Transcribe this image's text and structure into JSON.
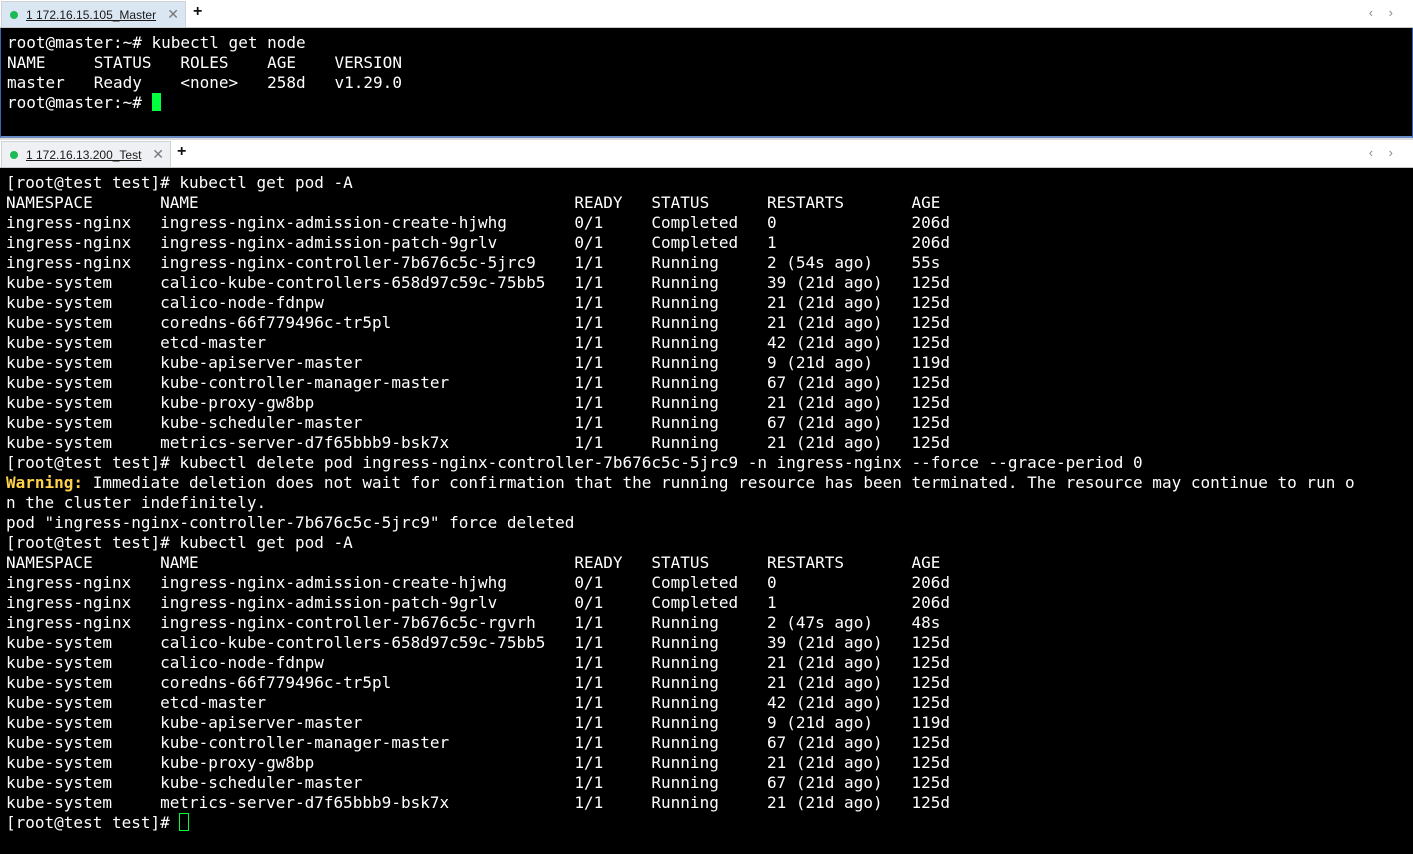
{
  "tabs": {
    "top": {
      "title": "1 172.16.15.105_Master",
      "status_color": "#1db954",
      "close": "✕",
      "new": "+",
      "nav": "‹ ›"
    },
    "bottom": {
      "title": "1 172.16.13.200_Test",
      "status_color": "#1db954",
      "close": "✕",
      "new": "+",
      "nav": "‹ ›"
    }
  },
  "master_terminal": {
    "lines": [
      "root@master:~# kubectl get node",
      "NAME     STATUS   ROLES    AGE    VERSION",
      "master   Ready    <none>   258d   v1.29.0",
      "root@master:~# "
    ]
  },
  "test_terminal": {
    "lines": [
      "[root@test test]# kubectl get pod -A",
      "NAMESPACE       NAME                                       READY   STATUS      RESTARTS       AGE",
      "ingress-nginx   ingress-nginx-admission-create-hjwhg       0/1     Completed   0              206d",
      "ingress-nginx   ingress-nginx-admission-patch-9grlv        0/1     Completed   1              206d",
      "ingress-nginx   ingress-nginx-controller-7b676c5c-5jrc9    1/1     Running     2 (54s ago)    55s",
      "kube-system     calico-kube-controllers-658d97c59c-75bb5   1/1     Running     39 (21d ago)   125d",
      "kube-system     calico-node-fdnpw                          1/1     Running     21 (21d ago)   125d",
      "kube-system     coredns-66f779496c-tr5pl                   1/1     Running     21 (21d ago)   125d",
      "kube-system     etcd-master                                1/1     Running     42 (21d ago)   125d",
      "kube-system     kube-apiserver-master                      1/1     Running     9 (21d ago)    119d",
      "kube-system     kube-controller-manager-master             1/1     Running     67 (21d ago)   125d",
      "kube-system     kube-proxy-gw8bp                           1/1     Running     21 (21d ago)   125d",
      "kube-system     kube-scheduler-master                      1/1     Running     67 (21d ago)   125d",
      "kube-system     metrics-server-d7f65bbb9-bsk7x             1/1     Running     21 (21d ago)   125d",
      "[root@test test]# kubectl delete pod ingress-nginx-controller-7b676c5c-5jrc9 -n ingress-nginx --force --grace-period 0"
    ],
    "warning_label": "Warning:",
    "warning_rest": " Immediate deletion does not wait for confirmation that the running resource has been terminated. The resource may continue to run o",
    "warning_wrap": "n the cluster indefinitely.",
    "lines_after": [
      "pod \"ingress-nginx-controller-7b676c5c-5jrc9\" force deleted",
      "[root@test test]# kubectl get pod -A",
      "NAMESPACE       NAME                                       READY   STATUS      RESTARTS       AGE",
      "ingress-nginx   ingress-nginx-admission-create-hjwhg       0/1     Completed   0              206d",
      "ingress-nginx   ingress-nginx-admission-patch-9grlv        0/1     Completed   1              206d",
      "ingress-nginx   ingress-nginx-controller-7b676c5c-rgvrh    1/1     Running     2 (47s ago)    48s",
      "kube-system     calico-kube-controllers-658d97c59c-75bb5   1/1     Running     39 (21d ago)   125d",
      "kube-system     calico-node-fdnpw                          1/1     Running     21 (21d ago)   125d",
      "kube-system     coredns-66f779496c-tr5pl                   1/1     Running     21 (21d ago)   125d",
      "kube-system     etcd-master                                1/1     Running     42 (21d ago)   125d",
      "kube-system     kube-apiserver-master                      1/1     Running     9 (21d ago)    119d",
      "kube-system     kube-controller-manager-master             1/1     Running     67 (21d ago)   125d",
      "kube-system     kube-proxy-gw8bp                           1/1     Running     21 (21d ago)   125d",
      "kube-system     kube-scheduler-master                      1/1     Running     67 (21d ago)   125d",
      "kube-system     metrics-server-d7f65bbb9-bsk7x             1/1     Running     21 (21d ago)   125d"
    ],
    "prompt_final": "[root@test test]# "
  },
  "colors": {
    "cursor": "#00ff3c",
    "warning": "#ffd24a",
    "terminal_bg": "#000000",
    "terminal_fg": "#ffffff"
  }
}
